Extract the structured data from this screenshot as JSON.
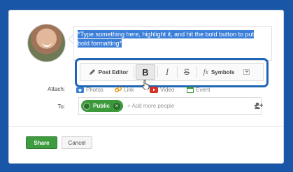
{
  "post": {
    "text": "*Type something here, highlight it, and hit the bold button to put bold formatting*"
  },
  "toolbar": {
    "post_editor_label": "Post Editor",
    "bold_label": "B",
    "italic_label": "I",
    "strike_label": "S",
    "fx_label": "fx",
    "symbols_label": "Symbols"
  },
  "attach": {
    "label": "Attach:",
    "items": [
      {
        "label": "Photos",
        "icon": "camera-icon"
      },
      {
        "label": "Link",
        "icon": "link-icon"
      },
      {
        "label": "Video",
        "icon": "video-icon"
      },
      {
        "label": "Event",
        "icon": "calendar-icon"
      }
    ]
  },
  "to": {
    "label": "To:",
    "chip_label": "Public",
    "placeholder": "+ Add more people"
  },
  "actions": {
    "share_label": "Share",
    "cancel_label": "Cancel"
  },
  "colors": {
    "accent": "#3b7fd9",
    "share_green": "#3f9b3f",
    "highlight_ring": "#1f66b5",
    "background": "#1a56a8"
  }
}
